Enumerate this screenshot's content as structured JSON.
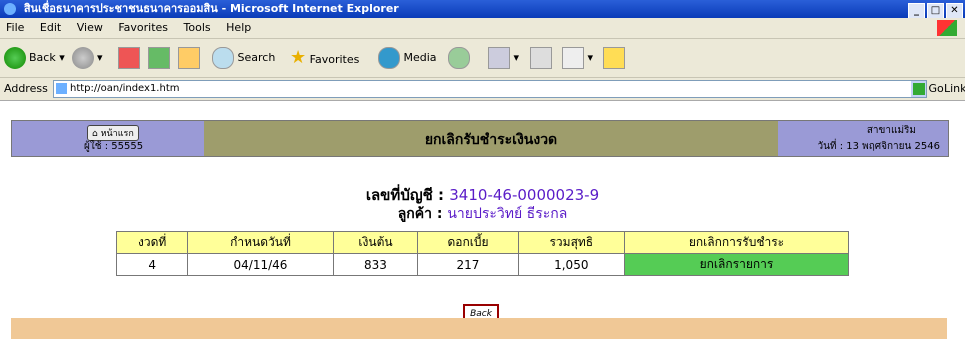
{
  "window": {
    "title": "สินเชื่อธนาคารประชาชนธนาคารออมสิน - Microsoft Internet Explorer",
    "controls": [
      "_",
      "□",
      "✕"
    ]
  },
  "menu": [
    "File",
    "Edit",
    "View",
    "Favorites",
    "Tools",
    "Help"
  ],
  "toolbar": {
    "back": "Back",
    "search": "Search",
    "favorites": "Favorites",
    "media": "Media"
  },
  "address": {
    "label": "Address",
    "url": "http://oan/index1.htm",
    "go": "Go",
    "links": "Links"
  },
  "header": {
    "home_button": "หน้าแรก",
    "user": "ผู้ใช้ : 55555",
    "title": "ยกเลิกรับชำระเงินงวด",
    "branch": "สาขาแม่ริม",
    "date": "วันที่ : 13 พฤศจิกายน 2546"
  },
  "account": {
    "label": "เลขที่บัญชี :",
    "value": "3410-46-0000023-9"
  },
  "customer": {
    "label": "ลูกค้า :",
    "value": "นายประวิทย์ ธีระกล"
  },
  "table": {
    "headers": [
      "งวดที่",
      "กำหนดวันที่",
      "เงินต้น",
      "ดอกเบี้ย",
      "รวมสุทธิ",
      "ยกเลิกการรับชำระ"
    ],
    "rows": [
      [
        "4",
        "04/11/46",
        "833",
        "217",
        "1,050",
        "ยกเลิกรายการ"
      ]
    ]
  },
  "back_button": "Back",
  "colors": {
    "header_bg": "#9e9d6c",
    "side_bg": "#9a9ad6",
    "table_header": "#ffff99",
    "cancel_cell": "#55cc55",
    "footer": "#f0c896"
  }
}
